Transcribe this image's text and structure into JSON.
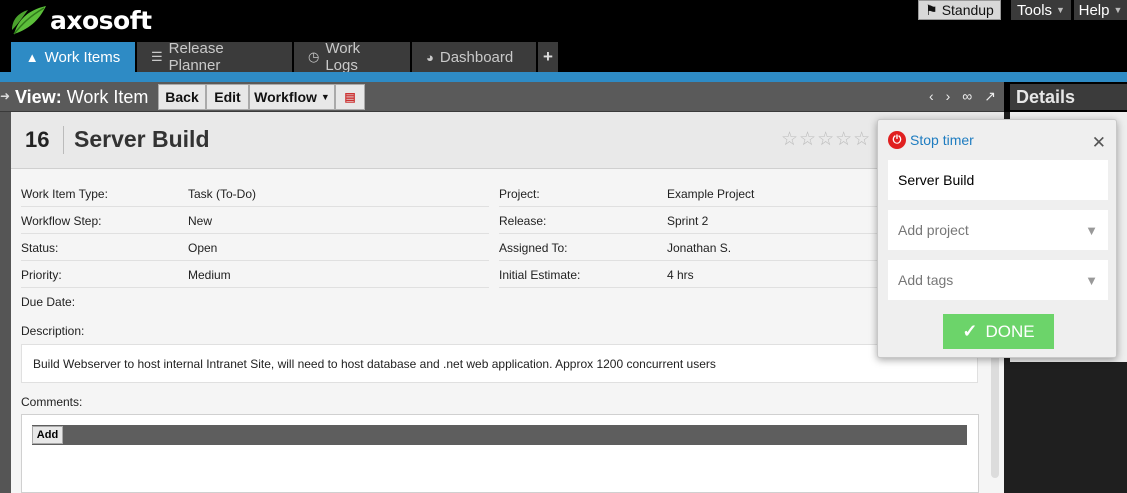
{
  "app": {
    "brand": "axosoft",
    "accent": "#2e8bc5",
    "done_color": "#6cd46a"
  },
  "topbar": {
    "standup_label": "Standup",
    "tools_label": "Tools",
    "help_label": "Help"
  },
  "tabs": [
    {
      "label": "Work Items",
      "icon": "work-items-icon"
    },
    {
      "label": "Release Planner",
      "icon": "sliders-icon"
    },
    {
      "label": "Work Logs",
      "icon": "clock-icon"
    },
    {
      "label": "Dashboard",
      "icon": "gauge-icon"
    }
  ],
  "toolbar": {
    "view_prefix": "View:",
    "view_name": "Work Item",
    "back_label": "Back",
    "edit_label": "Edit",
    "workflow_label": "Workflow"
  },
  "details": {
    "title": "Details"
  },
  "item": {
    "number": "16",
    "title": "Server Build",
    "fields_left": [
      {
        "label": "Work Item Type:",
        "value": "Task (To-Do)"
      },
      {
        "label": "Workflow Step:",
        "value": "New"
      },
      {
        "label": "Status:",
        "value": "Open"
      },
      {
        "label": "Priority:",
        "value": "Medium"
      },
      {
        "label": "Due Date:",
        "value": ""
      }
    ],
    "fields_right": [
      {
        "label": "Project:",
        "value": "Example Project"
      },
      {
        "label": "Release:",
        "value": "Sprint 2"
      },
      {
        "label": "Assigned To:",
        "value": "Jonathan S."
      },
      {
        "label": "Initial Estimate:",
        "value": "4 hrs"
      }
    ],
    "description_label": "Description:",
    "description": "Build Webserver to host internal Intranet Site, will need to host database and .net web application. Approx 1200 concurrent users",
    "comments_label": "Comments:",
    "add_label": "Add",
    "rating": 0
  },
  "timer": {
    "stop_label": "Stop timer",
    "name_value": "Server Build",
    "project_placeholder": "Add project",
    "tags_placeholder": "Add tags",
    "done_label": "DONE"
  }
}
